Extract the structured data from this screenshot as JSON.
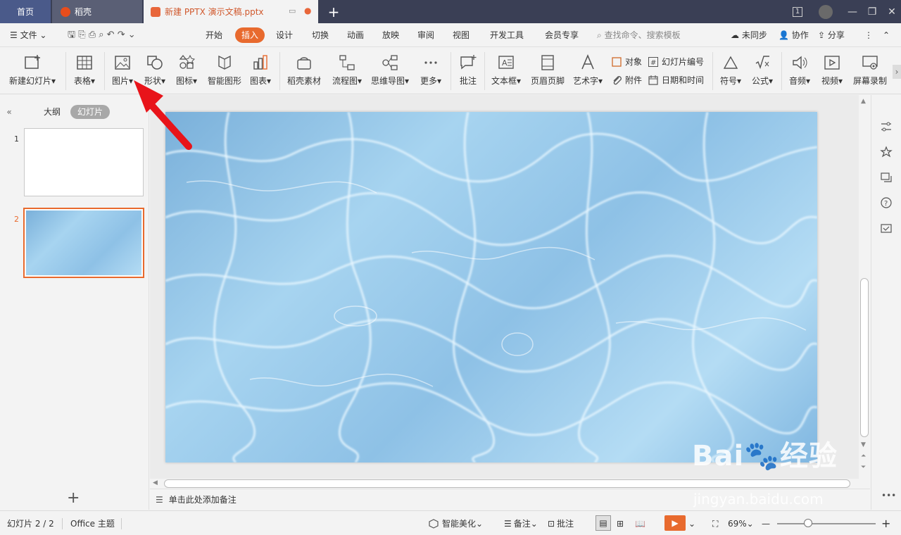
{
  "titlebar": {
    "tabs": [
      {
        "label": "首页"
      },
      {
        "label": "稻壳"
      },
      {
        "label": "新建 PPTX 演示文稿.pptx"
      }
    ],
    "page_indicator": "1"
  },
  "menubar": {
    "file": "文件",
    "tabs": [
      "开始",
      "插入",
      "设计",
      "切换",
      "动画",
      "放映",
      "审阅",
      "视图",
      "开发工具",
      "会员专享"
    ],
    "active_tab": "插入",
    "search_placeholder": "查找命令、搜索模板",
    "sync": "未同步",
    "collab": "协作",
    "share": "分享"
  },
  "ribbon": {
    "new_slide": "新建幻灯片",
    "table": "表格",
    "picture": "图片",
    "shape": "形状",
    "icon": "图标",
    "smart_graphic": "智能图形",
    "chart": "图表",
    "daoke_material": "稻壳素材",
    "flowchart": "流程图",
    "mindmap": "思维导图",
    "more": "更多",
    "comment": "批注",
    "textbox": "文本框",
    "header_footer": "页眉页脚",
    "wordart": "艺术字",
    "object": "对象",
    "attachment": "附件",
    "slide_number": "幻灯片编号",
    "datetime": "日期和时间",
    "symbol": "符号",
    "formula": "公式",
    "audio": "音频",
    "video": "视频",
    "screen_record": "屏幕录制"
  },
  "leftpanel": {
    "outline": "大纲",
    "slides": "幻灯片",
    "thumbs": [
      {
        "num": "1"
      },
      {
        "num": "2"
      }
    ]
  },
  "notes": {
    "placeholder": "单击此处添加备注"
  },
  "statusbar": {
    "slide_info": "幻灯片 2 / 2",
    "theme": "Office 主题",
    "smart_beautify": "智能美化",
    "notes": "备注",
    "comments": "批注",
    "zoom": "69%"
  },
  "watermark": {
    "brand": "Bai",
    "brand2": "经验",
    "url": "jingyan.baidu.com"
  },
  "colors": {
    "accent": "#e86a2e",
    "titlebar": "#3a3f55",
    "arrow": "#e8141a"
  }
}
